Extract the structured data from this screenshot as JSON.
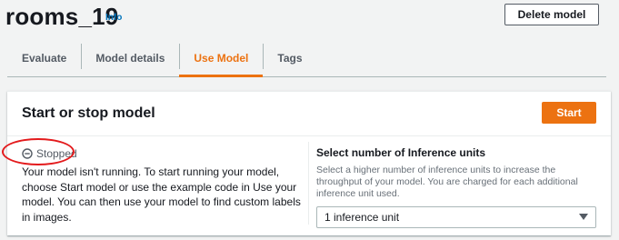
{
  "header": {
    "title": "rooms_19",
    "info_link": "Info",
    "delete_label": "Delete model"
  },
  "tabs": [
    {
      "label": "Evaluate",
      "active": false
    },
    {
      "label": "Model details",
      "active": false
    },
    {
      "label": "Use Model",
      "active": true
    },
    {
      "label": "Tags",
      "active": false
    }
  ],
  "card": {
    "title": "Start or stop model",
    "start_label": "Start",
    "status": {
      "label": "Stopped",
      "icon": "stopped-circle-icon"
    },
    "description": "Your model isn't running. To start running your model, choose Start model or use the example code in Use your model. You can then use your model to find custom labels in images.",
    "inference": {
      "label": "Select number of Inference units",
      "hint": "Select a higher number of inference units to increase the throughput of your model. You are charged for each additional inference unit used.",
      "selected": "1 inference unit"
    }
  },
  "colors": {
    "accent": "#ec7211",
    "link": "#0073bb",
    "annotation": "#e31a1c"
  }
}
